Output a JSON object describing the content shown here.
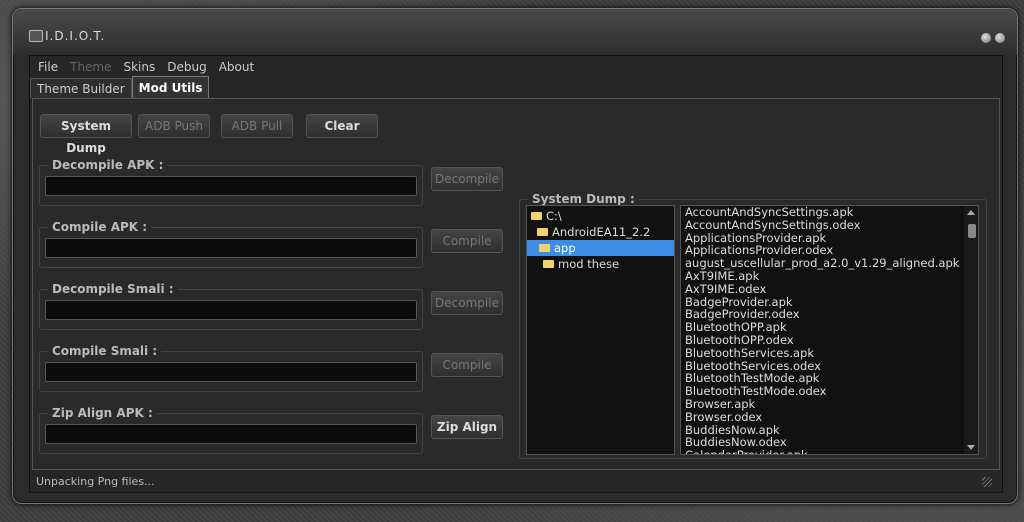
{
  "window": {
    "title": "I.D.I.O.T."
  },
  "menu": [
    {
      "label": "File",
      "disabled": false
    },
    {
      "label": "Theme",
      "disabled": true
    },
    {
      "label": "Skins",
      "disabled": false
    },
    {
      "label": "Debug",
      "disabled": false
    },
    {
      "label": "About",
      "disabled": false
    }
  ],
  "tabs": [
    {
      "label": "Theme Builder",
      "active": false
    },
    {
      "label": "Mod Utils",
      "active": true
    }
  ],
  "toolbar": {
    "system_dump": "System Dump",
    "adb_push": "ADB Push",
    "adb_pull": "ADB Pull",
    "clear": "Clear"
  },
  "groups": [
    {
      "label": "Decompile APK :",
      "value": "",
      "button": "Decompile",
      "button_disabled": true
    },
    {
      "label": "Compile APK :",
      "value": "",
      "button": "Compile",
      "button_disabled": true
    },
    {
      "label": "Decompile Smali :",
      "value": "",
      "button": "Decompile",
      "button_disabled": true
    },
    {
      "label": "Compile Smali :",
      "value": "",
      "button": "Compile",
      "button_disabled": true
    },
    {
      "label": "Zip Align APK :",
      "value": "",
      "button": "Zip Align",
      "button_disabled": false
    }
  ],
  "system_dump": {
    "label": "System Dump :",
    "tree": [
      {
        "label": "C:\\",
        "level": 0,
        "selected": false
      },
      {
        "label": "AndroidEA11_2.2",
        "level": 1,
        "selected": false
      },
      {
        "label": "app",
        "level": 2,
        "selected": true
      },
      {
        "label": "mod these",
        "level": 3,
        "selected": false
      }
    ],
    "files": [
      "AccountAndSyncSettings.apk",
      "AccountAndSyncSettings.odex",
      "ApplicationsProvider.apk",
      "ApplicationsProvider.odex",
      "august_uscellular_prod_a2.0_v1.29_aligned.apk",
      "AxT9IME.apk",
      "AxT9IME.odex",
      "BadgeProvider.apk",
      "BadgeProvider.odex",
      "BluetoothOPP.apk",
      "BluetoothOPP.odex",
      "BluetoothServices.apk",
      "BluetoothServices.odex",
      "BluetoothTestMode.apk",
      "BluetoothTestMode.odex",
      "Browser.apk",
      "Browser.odex",
      "BuddiesNow.apk",
      "BuddiesNow.odex",
      "CalendarProvider.apk"
    ]
  },
  "status": {
    "text": "Unpacking Png files..."
  }
}
